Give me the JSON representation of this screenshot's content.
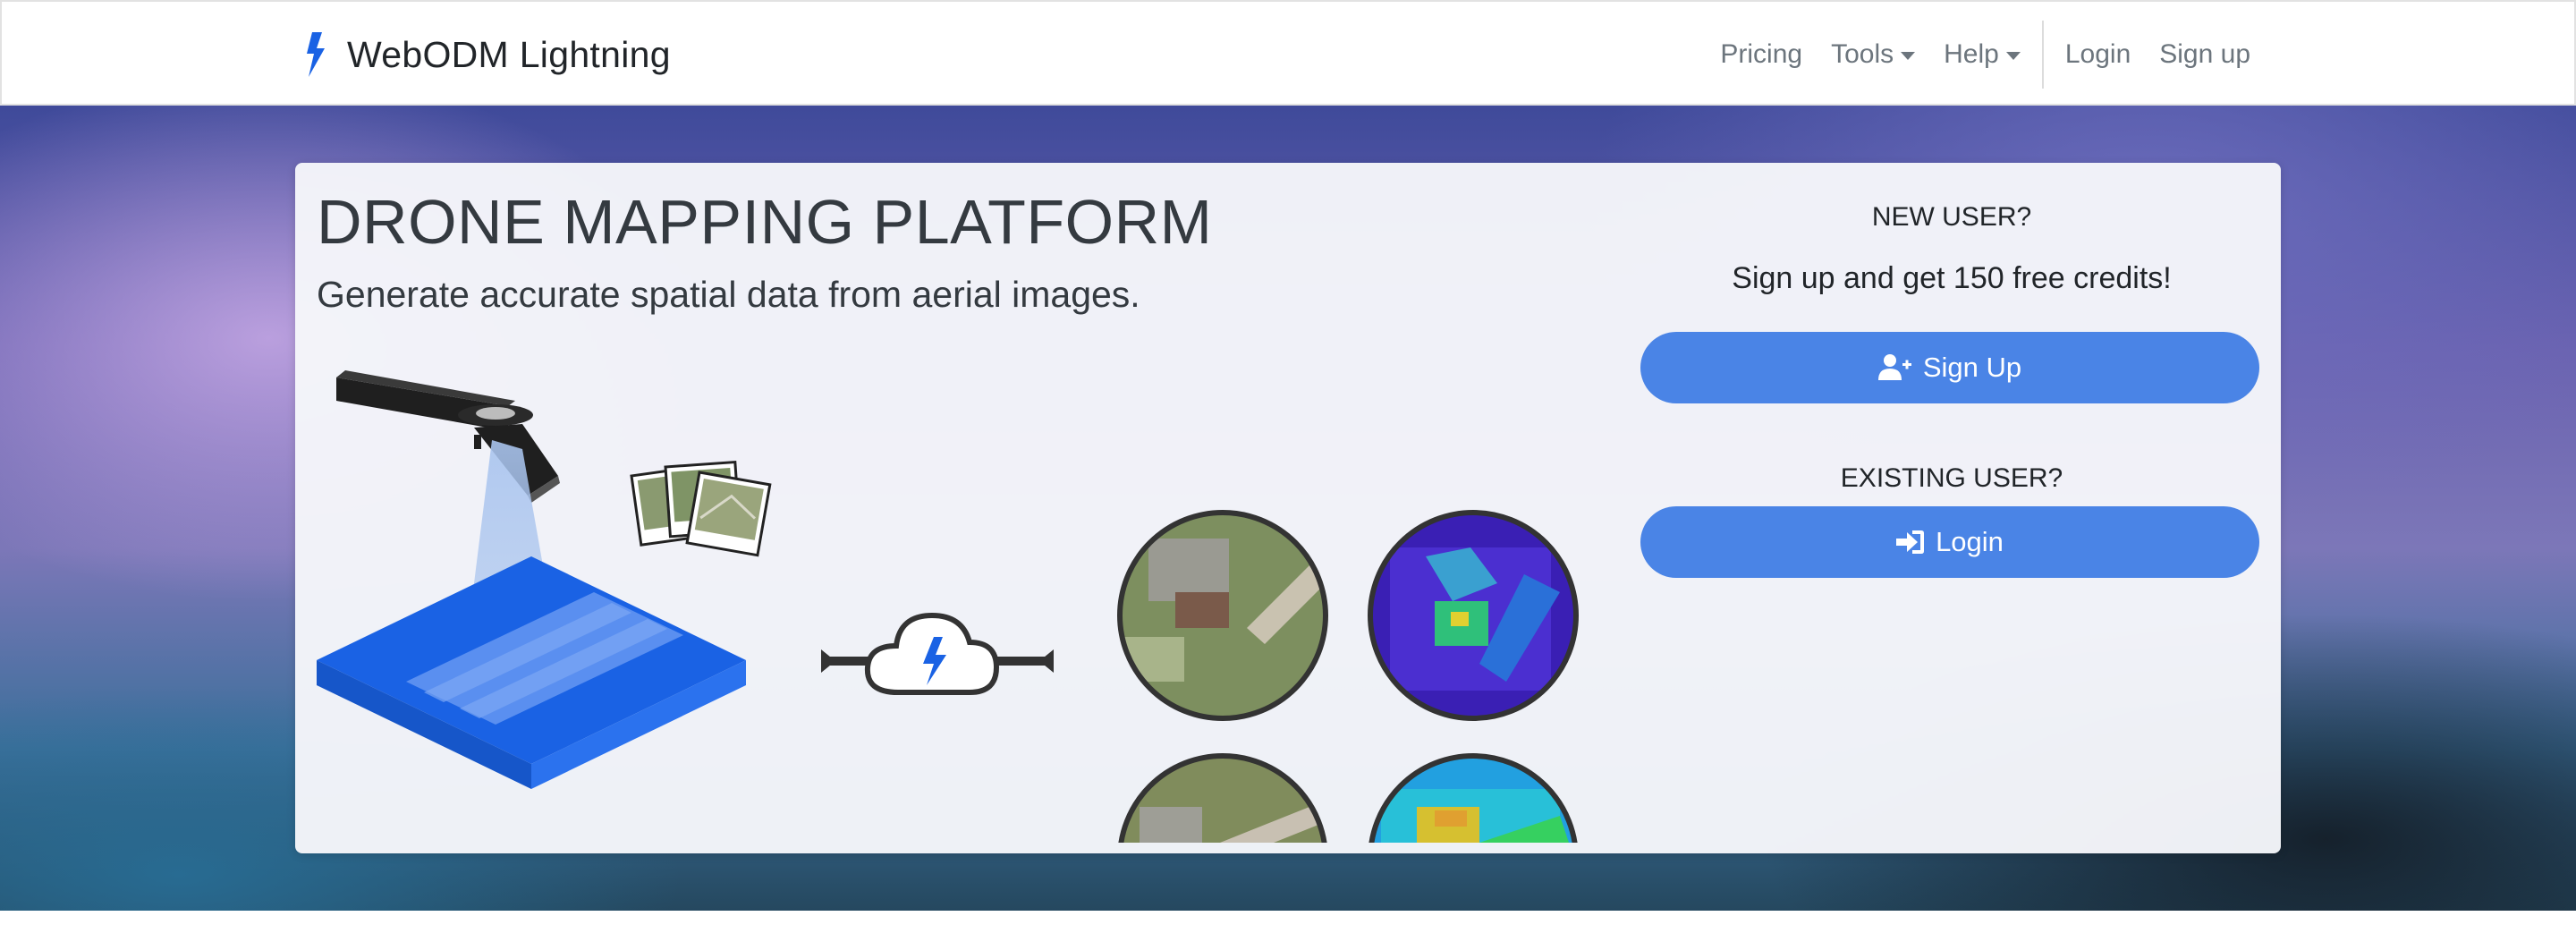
{
  "nav": {
    "brand": "WebODM Lightning",
    "links": {
      "pricing": "Pricing",
      "tools": "Tools",
      "help": "Help",
      "login": "Login",
      "signup": "Sign up"
    }
  },
  "hero": {
    "title": "DRONE MAPPING PLATFORM",
    "subtitle": "Generate accurate spatial data from aerial images."
  },
  "auth": {
    "new_user_label": "NEW USER?",
    "promo": "Sign up and get 150 free credits!",
    "signup_button": "Sign Up",
    "existing_user_label": "EXISTING USER?",
    "login_button": "Login"
  },
  "colors": {
    "brand_blue": "#1a62e4",
    "button_blue": "#4a84e6",
    "text_dark": "#343a40",
    "nav_link": "#6c757d"
  },
  "icons": {
    "brand": "lightning-bolt-icon",
    "signup": "user-plus-icon",
    "login": "sign-in-icon"
  }
}
